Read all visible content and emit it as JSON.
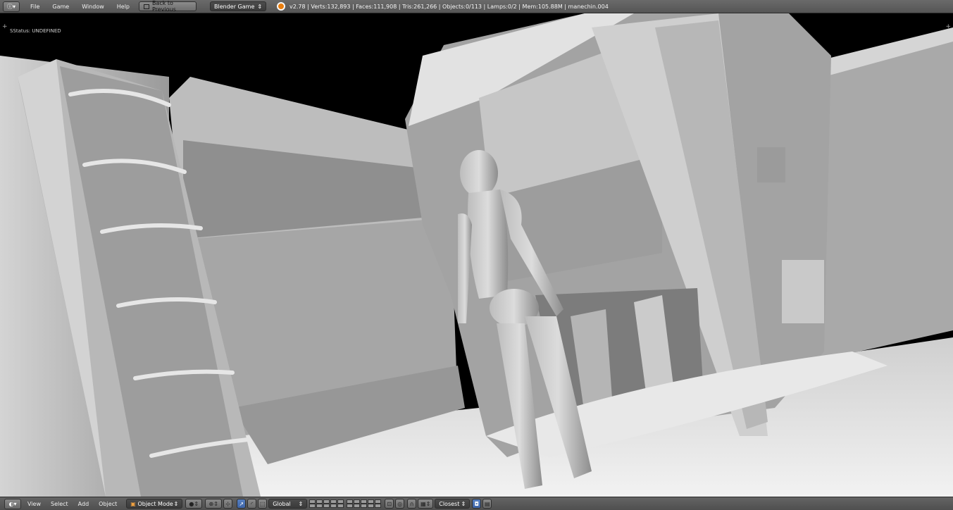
{
  "topbar": {
    "menus": [
      "File",
      "Game",
      "Window",
      "Help"
    ],
    "back_button": "Back to Previous",
    "engine_select": "Blender Game",
    "stats": "v2.78 | Verts:132,893 | Faces:111,908 | Tris:261,266 | Objects:0/113 | Lamps:0/2 | Mem:105.88M | manechin.004"
  },
  "viewport": {
    "status_text": "SStatus: UNDEFINED"
  },
  "bottombar": {
    "menus": [
      "View",
      "Select",
      "Add",
      "Object"
    ],
    "mode_select": "Object Mode",
    "orientation_select": "Global",
    "snap_target_select": "Closest"
  },
  "colors": {
    "header_bg": "#5a5a5a",
    "active_blue": "#4a72b5",
    "blender_orange": "#e87d0d"
  }
}
